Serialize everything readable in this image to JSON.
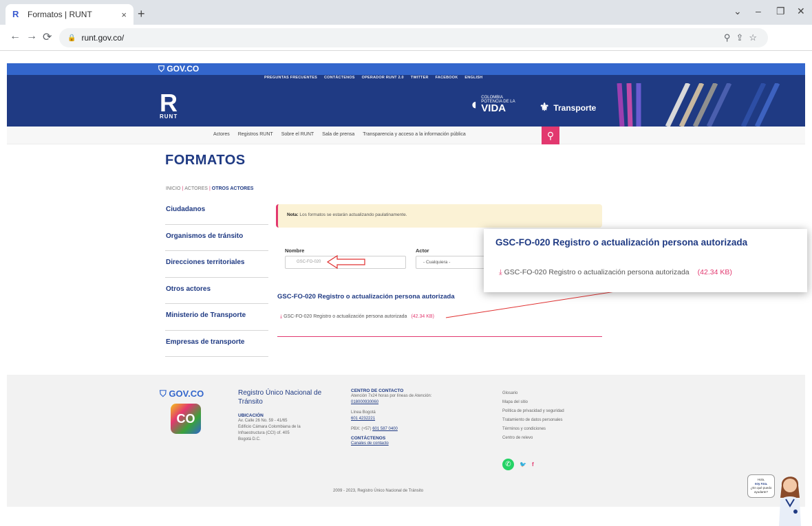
{
  "browser": {
    "tab_title": "Formatos | RUNT",
    "tab_close": "×",
    "new_tab": "+",
    "url": "runt.gov.co/",
    "window_controls": [
      "⌄",
      "–",
      "❐",
      "✕"
    ]
  },
  "site": {
    "gov_label": "GOV.CO",
    "top_links": [
      "PREGUNTAS FRECUENTES",
      "CONTÁCTENOS",
      "OPERADOR RUNT 2.0",
      "TWITTER",
      "FACEBOOK",
      "ENGLISH"
    ],
    "logo_text": "RUNT",
    "colombia_small": "COLOMBIA",
    "colombia_sub": "POTENCIA DE LA",
    "colombia_vida": "VIDA",
    "transporte": "Transporte",
    "main_nav": [
      "Actores",
      "Registros RUNT",
      "Sobre el RUNT",
      "Sala de prensa",
      "Transparencia y acceso a la información pública"
    ]
  },
  "page": {
    "title": "FORMATOS",
    "breadcrumb": [
      "INICIO",
      "ACTORES",
      "OTROS ACTORES"
    ],
    "sidebar": [
      "Ciudadanos",
      "Organismos de tránsito",
      "Direcciones territoriales",
      "Otros actores",
      "Ministerio de Transporte",
      "Empresas de transporte"
    ],
    "note_label": "Nota:",
    "note_text": " Los formatos se estarán actualizando paulatinamente.",
    "filter_nombre_label": "Nombre",
    "filter_nombre_value": "GSC-FO-020",
    "filter_actor_label": "Actor",
    "filter_actor_value": "- Cualquiera -",
    "result_title": "GSC-FO-020 Registro o actualización persona autorizada",
    "result_link": "GSC-FO-020 Registro o actualización persona autorizada",
    "result_size": "(42.34 KB)"
  },
  "popup": {
    "title": "GSC-FO-020 Registro o actualización persona autorizada",
    "link": "GSC-FO-020 Registro o actualización persona autorizada",
    "size": "(42.34 KB)"
  },
  "footer": {
    "gov_label": "GOV.CO",
    "co_label": "CO",
    "org_name": "Registro Único Nacional de Tránsito",
    "ubicacion_label": "UBICACIÓN",
    "ubicacion_lines": [
      "Av. Calle 26 No. 59 - 41/65",
      "Edificio Cámara Colombiana de la",
      "Infraestructura (CCI) of. 405",
      "Bogotá D.C."
    ],
    "contact_label": "CENTRO DE CONTACTO",
    "contact_hours": "Atención 7x24 horas por líneas de Atención:",
    "contact_phone1": "018000930060",
    "linea_bogota_label": "Línea Bogotá",
    "linea_bogota": "601 4232221",
    "pbx_label": "PBX: (+57)",
    "pbx": "601 587 0400",
    "contactenos_label": "CONTÁCTENOS",
    "contactenos_link": "Canales de contacto",
    "links": [
      "Glosario",
      "Mapa del sitio",
      "Política de privacidad y seguridad",
      "Tratamiento de datos personales",
      "Términos y condiciones",
      "Centro de relevo"
    ],
    "copyright": "2009 - 2023, Registro Único Nacional de Tránsito"
  },
  "assistant": {
    "line1": "Hola,",
    "line2": "soy Ana.",
    "line3": "¿En qué puedo",
    "line4": "ayudarte?"
  },
  "colors": {
    "navy": "#1f3a83",
    "gov_blue": "#3366cc",
    "accent_pink": "#e2386f",
    "annotation_red": "#e03030"
  }
}
